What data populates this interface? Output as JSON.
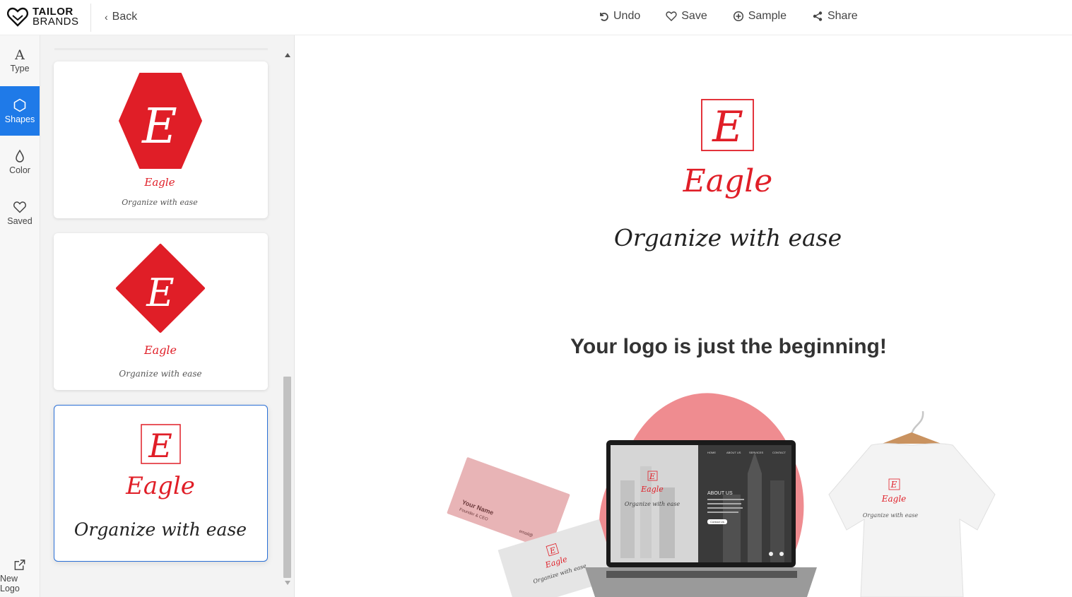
{
  "header": {
    "brand_line1": "TAILOR",
    "brand_line2": "BRANDS",
    "back_label": "Back",
    "actions": [
      {
        "label": "Undo",
        "icon": "undo-icon"
      },
      {
        "label": "Save",
        "icon": "heart-icon"
      },
      {
        "label": "Sample",
        "icon": "sample-icon"
      },
      {
        "label": "Share",
        "icon": "share-icon"
      }
    ]
  },
  "rail": {
    "items": [
      {
        "label": "Type",
        "icon": "type-icon"
      },
      {
        "label": "Shapes",
        "icon": "shapes-icon",
        "active": true
      },
      {
        "label": "Color",
        "icon": "droplet-icon"
      },
      {
        "label": "Saved",
        "icon": "heart-icon"
      }
    ],
    "new_logo_label": "New Logo"
  },
  "logo": {
    "monogram": "E",
    "name": "Eagle",
    "tagline": "Organize with ease",
    "accent": "#e01e27"
  },
  "panel": {
    "cards": [
      {
        "shape": "hexagon",
        "name": "Eagle",
        "tagline": "Organize with ease"
      },
      {
        "shape": "diamond",
        "name": "Eagle",
        "tagline": "Organize with ease"
      },
      {
        "shape": "square-outline",
        "name": "Eagle",
        "tagline": "Organize with ease",
        "selected": true
      }
    ]
  },
  "promo": {
    "title": "Your logo is just the beginning!",
    "card_name": "Your Name",
    "card_role": "Founder & CEO",
    "card_email": "email@",
    "site_nav": [
      "HOME",
      "ABOUT US",
      "SERVICES",
      "CONTACT"
    ],
    "site_heading": "ABOUT US",
    "site_button": "Contact Us",
    "blob_color": "#ef8c90"
  }
}
